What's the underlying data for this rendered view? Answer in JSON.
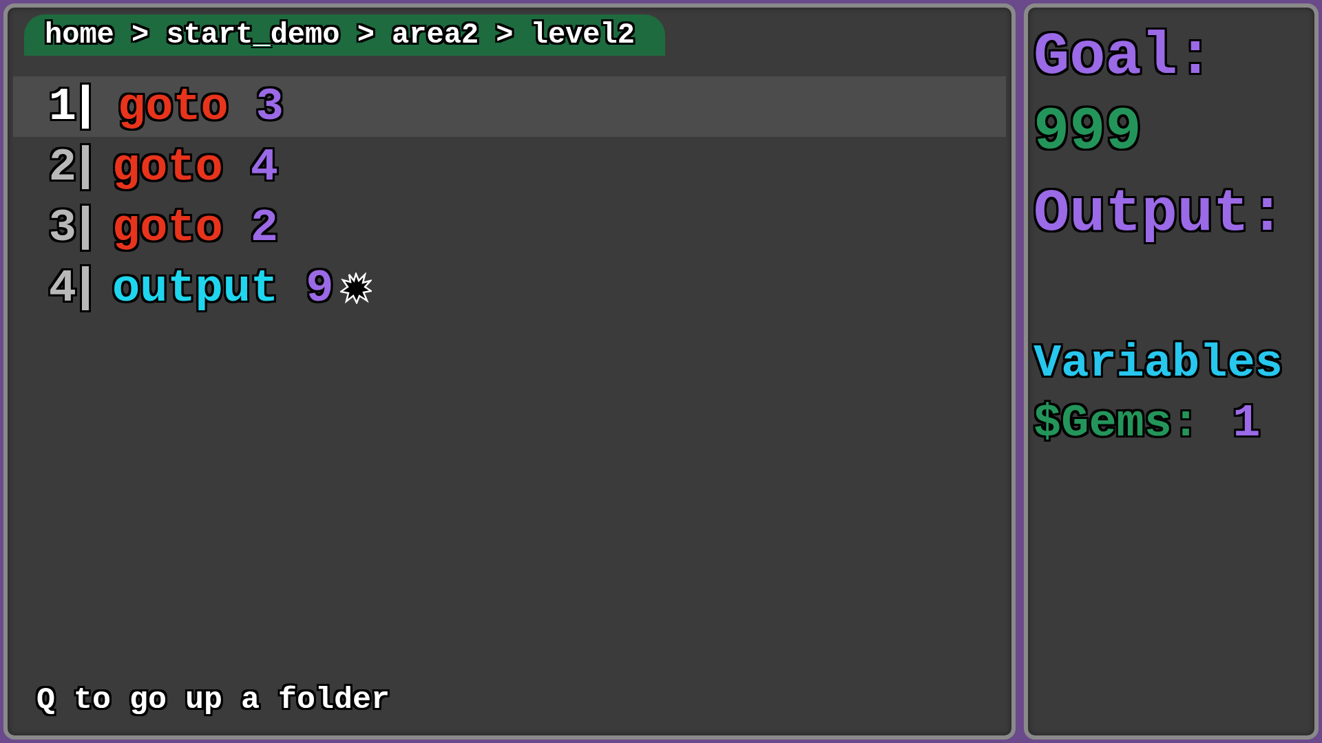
{
  "breadcrumb": "home > start_demo > area2 > level2",
  "code_lines": [
    {
      "number": "1",
      "selected": true,
      "tokens": [
        {
          "kind": "jump",
          "text": "goto"
        },
        {
          "kind": "number",
          "text": "3"
        }
      ]
    },
    {
      "number": "2",
      "selected": false,
      "tokens": [
        {
          "kind": "jump",
          "text": "goto"
        },
        {
          "kind": "number",
          "text": "4"
        }
      ]
    },
    {
      "number": "3",
      "selected": false,
      "tokens": [
        {
          "kind": "jump",
          "text": "goto"
        },
        {
          "kind": "number",
          "text": "2"
        }
      ]
    },
    {
      "number": "4",
      "selected": false,
      "splat": true,
      "tokens": [
        {
          "kind": "output",
          "text": "output"
        },
        {
          "kind": "number",
          "text": "9"
        }
      ]
    }
  ],
  "hint": "Q to go up a folder",
  "side_panel": {
    "goal_label": "Goal:",
    "goal_value": "999",
    "output_label": "Output:",
    "variables_label": "Variables",
    "variables": [
      {
        "name": "$Gems:",
        "value": "1"
      }
    ]
  }
}
